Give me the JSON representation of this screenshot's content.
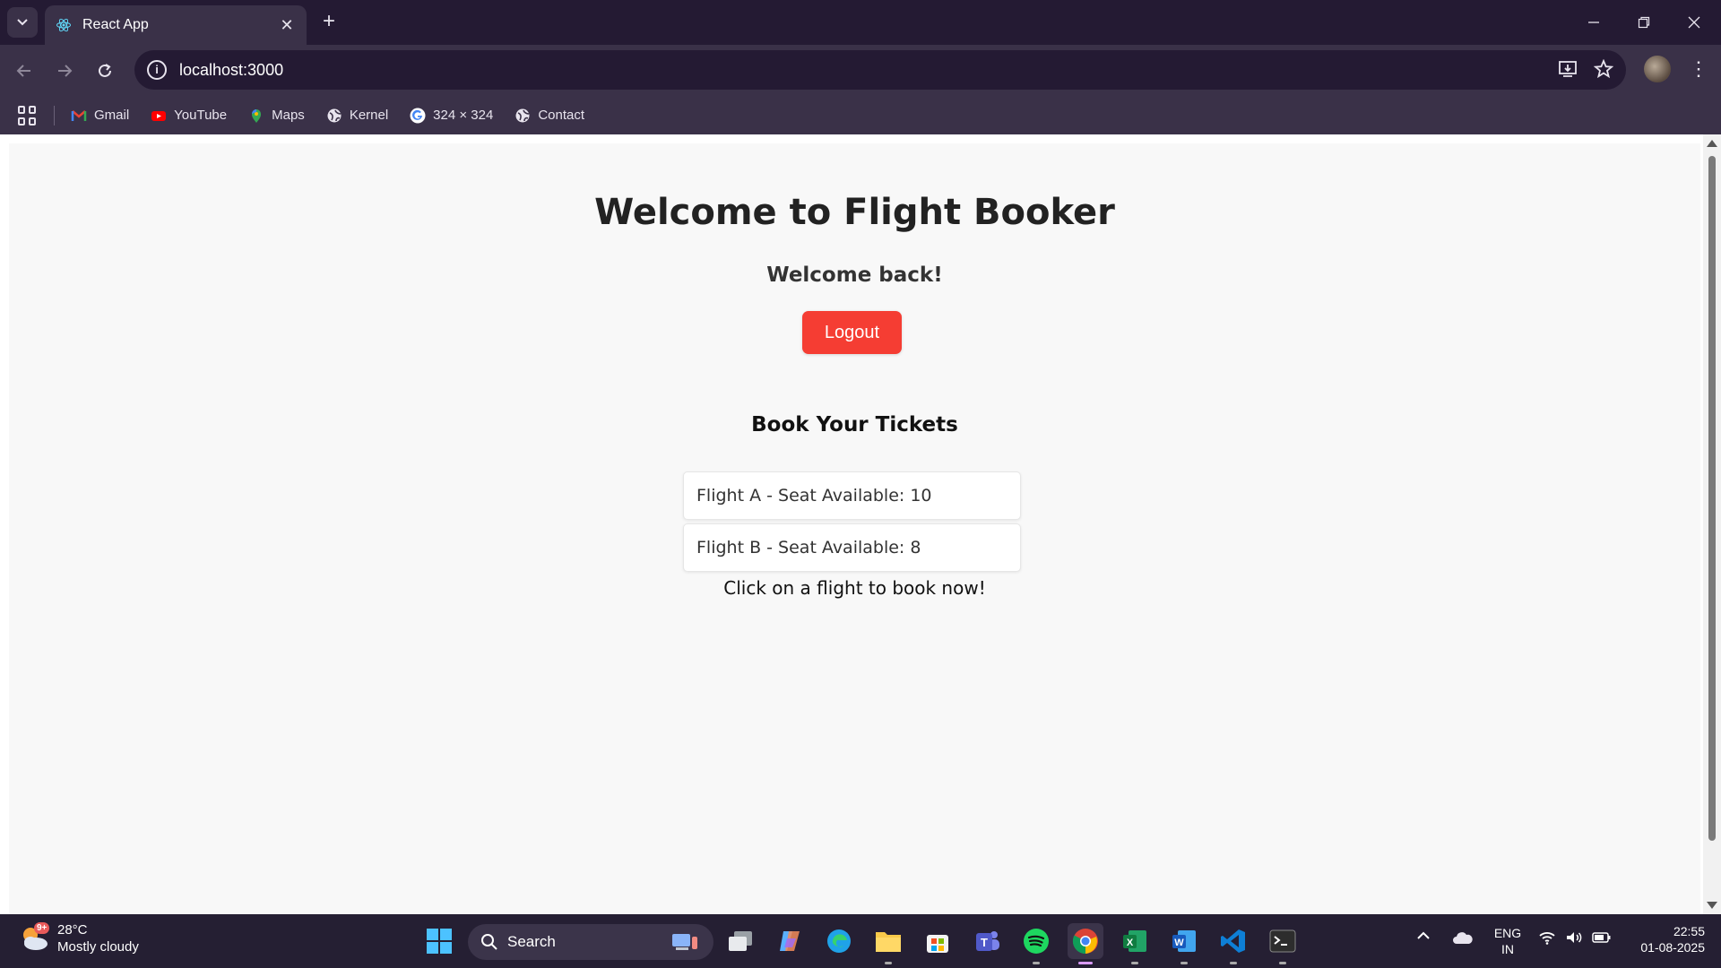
{
  "browser": {
    "tab_title": "React App",
    "url": "localhost:3000",
    "bookmarks": [
      {
        "label": "Gmail",
        "icon": "gmail-icon"
      },
      {
        "label": "YouTube",
        "icon": "youtube-icon"
      },
      {
        "label": "Maps",
        "icon": "maps-icon"
      },
      {
        "label": "Kernel",
        "icon": "globe-icon"
      },
      {
        "label": "324 × 324",
        "icon": "google-icon"
      },
      {
        "label": "Contact",
        "icon": "globe-icon"
      }
    ]
  },
  "page": {
    "title": "Welcome to Flight Booker",
    "welcome": "Welcome back!",
    "logout_label": "Logout",
    "section_title": "Book Your Tickets",
    "flights": [
      {
        "label": "Flight A - Seat Available: 10"
      },
      {
        "label": "Flight B - Seat Available: 8"
      }
    ],
    "cta": "Click on a flight to book now!",
    "accent_color": "#f53d33"
  },
  "taskbar": {
    "weather": {
      "temp": "28°C",
      "condition": "Mostly cloudy",
      "badge": "9+"
    },
    "search_label": "Search",
    "language": {
      "line1": "ENG",
      "line2": "IN"
    },
    "time": "22:55",
    "date": "01-08-2025"
  }
}
